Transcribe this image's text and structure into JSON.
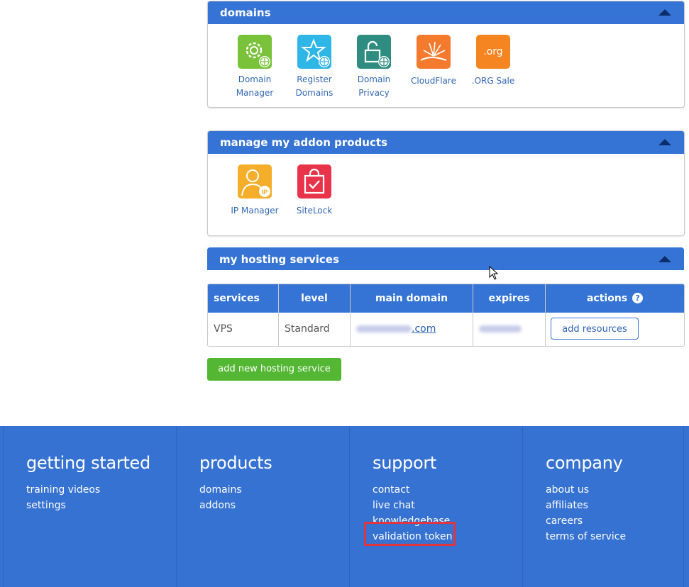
{
  "domains_panel": {
    "title": "domains",
    "tiles": [
      {
        "label_line1": "Domain",
        "label_line2": "Manager",
        "icon": "domain-manager-icon",
        "color": "#7ac23a"
      },
      {
        "label_line1": "Register",
        "label_line2": "Domains",
        "icon": "register-domains-icon",
        "color": "#2eb6e6"
      },
      {
        "label_line1": "Domain",
        "label_line2": "Privacy",
        "icon": "domain-privacy-icon",
        "color": "#2f8c80"
      },
      {
        "label_line1": "CloudFlare",
        "label_line2": "",
        "icon": "cloudflare-icon",
        "color": "#f47a2e"
      },
      {
        "label_line1": ".ORG Sale",
        "label_line2": "",
        "icon": "org-sale-icon",
        "color": "#f58520",
        "icon_text": ".org"
      }
    ]
  },
  "addons_panel": {
    "title": "manage my addon products",
    "tiles": [
      {
        "label": "IP Manager",
        "icon": "ip-manager-icon",
        "color": "#f5ae2a",
        "badge": "IP"
      },
      {
        "label": "SiteLock",
        "icon": "sitelock-icon",
        "color": "#e8334a"
      }
    ]
  },
  "hosting": {
    "title": "my hosting services",
    "columns": [
      "services",
      "level",
      "main domain",
      "expires",
      "actions"
    ],
    "rows": [
      {
        "service": "VPS",
        "level": "Standard",
        "domain_suffix": ".com",
        "action_label": "add resources"
      }
    ],
    "add_button": "add new hosting service"
  },
  "footer": {
    "columns": [
      {
        "heading": "getting started",
        "links": [
          "training videos",
          "settings"
        ]
      },
      {
        "heading": "products",
        "links": [
          "domains",
          "addons"
        ]
      },
      {
        "heading": "support",
        "links": [
          "contact",
          "live chat",
          "knowledgebase",
          "validation token"
        ]
      },
      {
        "heading": "company",
        "links": [
          "about us",
          "affiliates",
          "careers",
          "terms of service"
        ]
      }
    ]
  },
  "colors": {
    "header_blue": "#3574d4",
    "footer_blue": "#3672d1",
    "green": "#53b734",
    "highlight_red": "#e0343f"
  }
}
